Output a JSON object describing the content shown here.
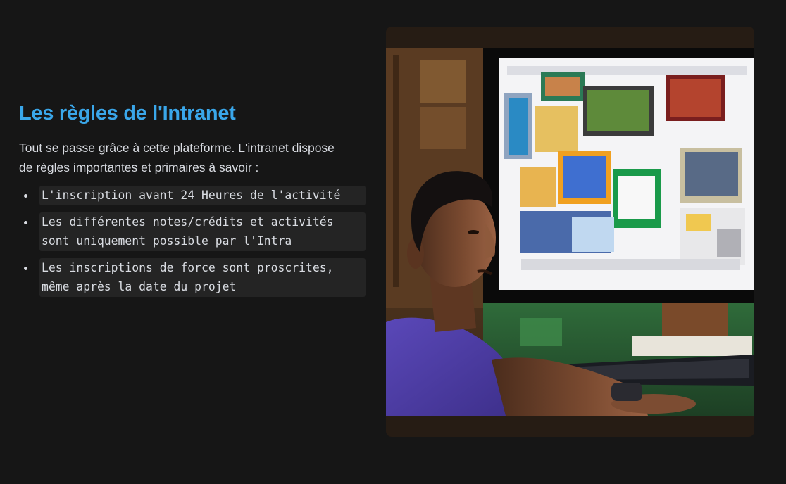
{
  "slide": {
    "title": "Les règles de l'Intranet",
    "intro": "Tout se passe grâce à cette plateforme. L'intranet dispose de règles importantes et primaires à savoir :",
    "rules": [
      "L'inscription avant 24 Heures de l'activité",
      "Les différentes notes/crédits et activités sont uniquement possible par l'Intra",
      "Les inscriptions de force sont proscrites, même après la date du projet"
    ]
  },
  "image": {
    "subject": "young man seated at a desk looking at a computer monitor displaying a collage of windows"
  },
  "colors": {
    "background": "#161616",
    "title": "#3aa7ea",
    "body_text": "#d9dce2",
    "code_background": "#242424",
    "image_frame": "#261c14"
  }
}
